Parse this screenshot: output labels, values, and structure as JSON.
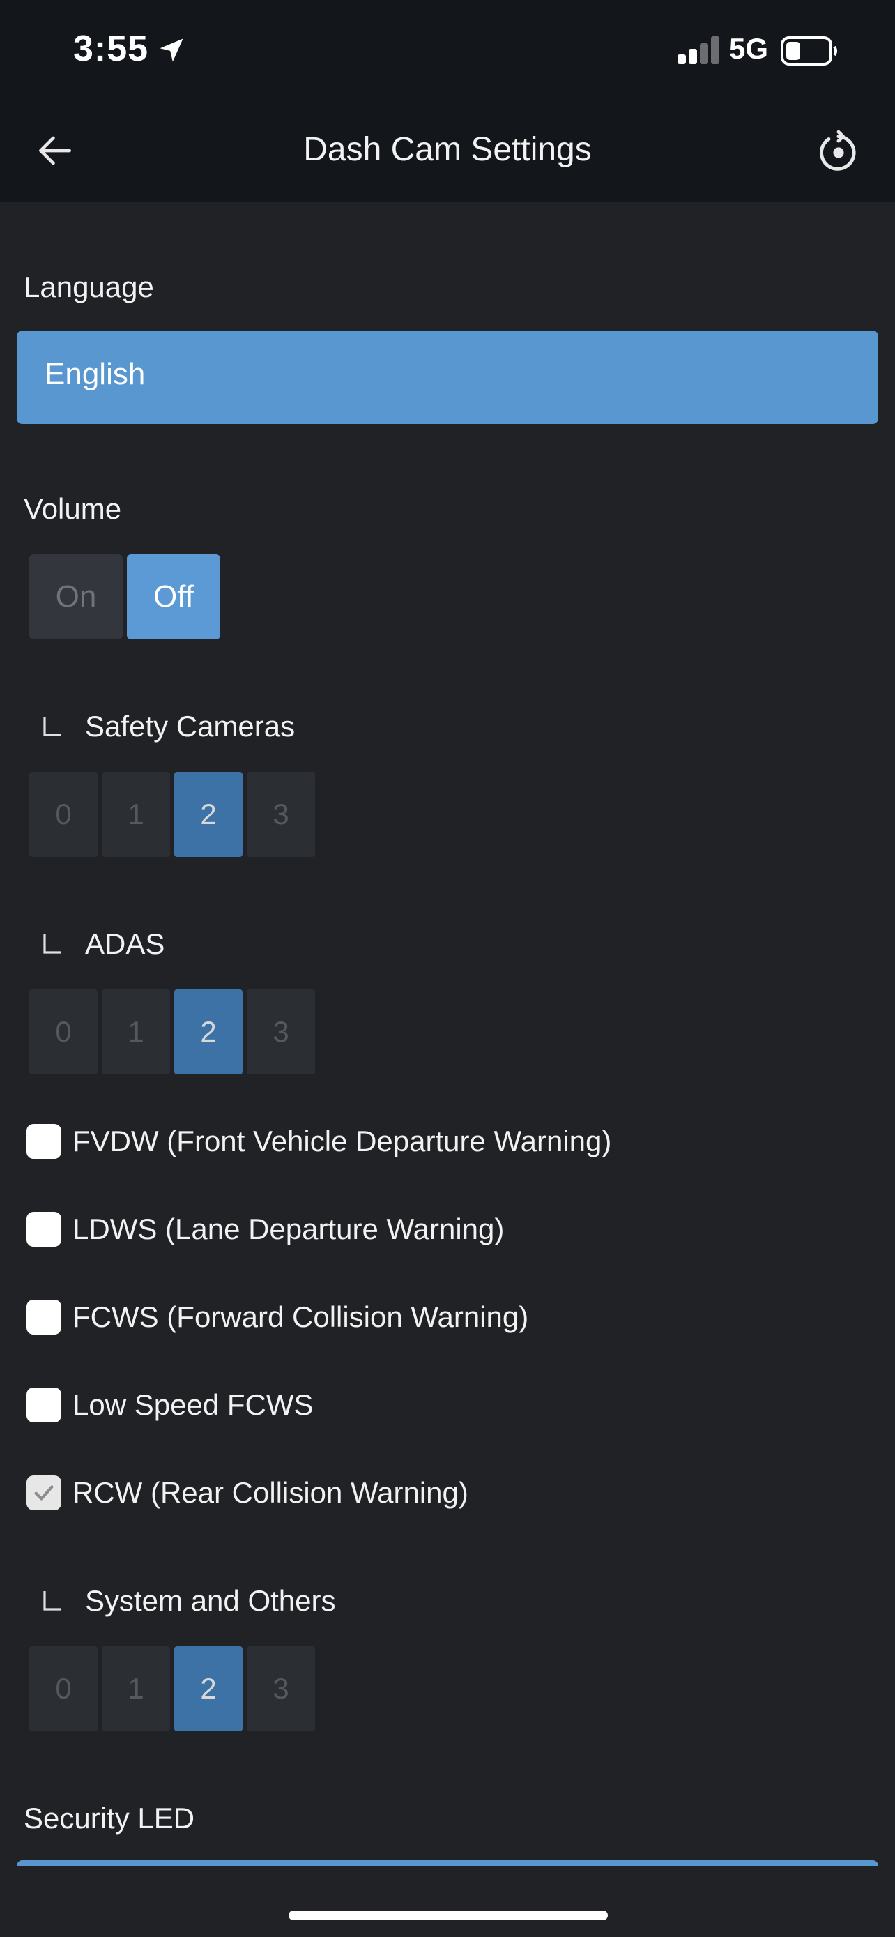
{
  "status_bar": {
    "time": "3:55",
    "network": "5G",
    "icons": [
      "location-arrow-icon",
      "signal-icon",
      "battery-icon"
    ]
  },
  "nav": {
    "title": "Dash Cam Settings",
    "back_icon": "back-arrow-icon",
    "reset_icon": "reset-icon"
  },
  "language": {
    "label": "Language",
    "value": "English"
  },
  "volume": {
    "label": "Volume",
    "options": [
      "On",
      "Off"
    ],
    "selected": "Off"
  },
  "safety_cameras": {
    "label": "Safety Cameras",
    "options": [
      "0",
      "1",
      "2",
      "3"
    ],
    "selected": "2"
  },
  "adas": {
    "label": "ADAS",
    "options": [
      "0",
      "1",
      "2",
      "3"
    ],
    "selected": "2"
  },
  "warnings": [
    {
      "label": "FVDW (Front Vehicle Departure Warning)",
      "checked": false
    },
    {
      "label": "LDWS (Lane Departure Warning)",
      "checked": false
    },
    {
      "label": "FCWS (Forward Collision Warning)",
      "checked": false
    },
    {
      "label": "Low Speed FCWS",
      "checked": false
    },
    {
      "label": "RCW (Rear Collision Warning)",
      "checked": true
    }
  ],
  "system_and_others": {
    "label": "System and Others",
    "options": [
      "0",
      "1",
      "2",
      "3"
    ],
    "selected": "2"
  },
  "security_led": {
    "label": "Security LED"
  },
  "colors": {
    "accent": "#5897cf",
    "selected_level": "#3d72a7",
    "background": "#202226",
    "header": "#13161a"
  }
}
